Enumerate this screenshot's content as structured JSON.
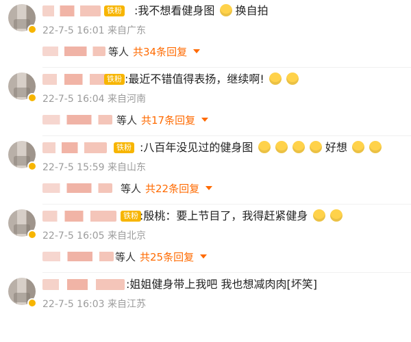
{
  "comments": [
    {
      "fan_badge": "铁粉",
      "text": ":我不想看健身图",
      "tail": "换自拍",
      "time": "22-7-5 16:01",
      "location": "来自广东",
      "reply_suffix": "等人",
      "reply_count": "共34条回复"
    },
    {
      "fan_badge": "铁粉",
      "text": ":最近不错值得表扬，继续啊!",
      "tail": "",
      "time": "22-7-5 16:04",
      "location": "来自河南",
      "reply_suffix": "等人",
      "reply_count": "共17条回复"
    },
    {
      "fan_badge": "铁粉",
      "text": ":八百年没见过的健身图",
      "tail": "好想",
      "time": "22-7-5 15:59",
      "location": "来自山东",
      "reply_suffix": "等人",
      "reply_count": "共22条回复"
    },
    {
      "fan_badge": "铁粉",
      "text": ":殷桃：要上节目了，我得赶紧健身",
      "tail": "",
      "time": "22-7-5 16:05",
      "location": "来自北京",
      "reply_suffix": "等人",
      "reply_count": "共25条回复"
    },
    {
      "fan_badge": "",
      "text": ":姐姐健身带上我吧 我也想减肉肉[坏笑]",
      "tail": "",
      "time": "22-7-5 16:03",
      "location": "来自江苏",
      "reply_suffix": "",
      "reply_count": ""
    }
  ],
  "colors": {
    "accent_orange": "#ff6a00",
    "badge_gold": "#f7b500",
    "meta_gray": "#9b9b9b"
  },
  "icons": {
    "vip_badge": "verified-badge-icon",
    "reply_caret": "chevron-down-icon",
    "emoji": "emoji-icon"
  }
}
